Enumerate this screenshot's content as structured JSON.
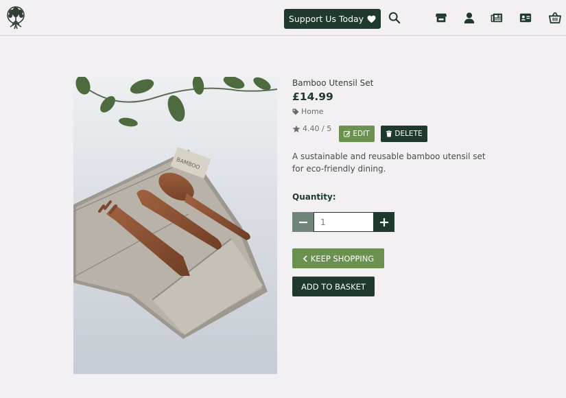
{
  "nav": {
    "support_label": "Support Us Today",
    "icons": [
      "tree-logo-icon",
      "search-icon",
      "store-icon",
      "user-icon",
      "news-icon",
      "id-card-icon",
      "basket-icon"
    ]
  },
  "product": {
    "name": "Bamboo Utensil Set",
    "price": "£14.99",
    "category": "Home",
    "rating": "4.40 / 5",
    "edit_label": "EDIT",
    "delete_label": "DELETE",
    "description": "A sustainable and reusable bamboo utensil set for eco-friendly dining.",
    "image_label": "BAMBOO"
  },
  "quantity": {
    "label": "Quantity:",
    "value": "1"
  },
  "actions": {
    "keep_shopping": "KEEP SHOPPING",
    "add_to_basket": "ADD TO BASKET"
  },
  "colors": {
    "dark_green": "#1f3a2c",
    "olive_green": "#6b9150",
    "muted_green": "#6f8578",
    "background": "#f2f0f3"
  }
}
